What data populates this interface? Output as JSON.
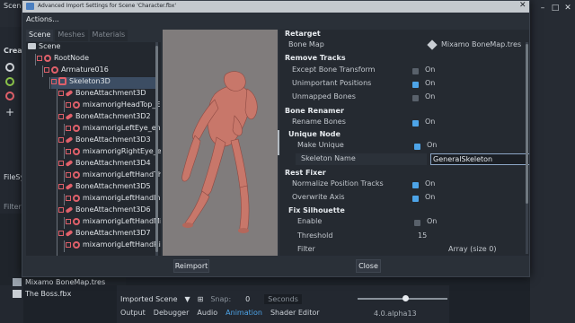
{
  "editor": {
    "scene_tab": "Scene",
    "create_label": "Creat",
    "filesystem_label": "FileSy",
    "filter_label": "Filter",
    "files": [
      "Mixamo BoneMap.tres",
      "The Boss.fbx"
    ],
    "animation_bar": {
      "imported_scene_label": "Imported Scene",
      "snap_label": "Snap:",
      "snap_value": "0",
      "seconds_label": "Seconds"
    },
    "bottom_tabs": [
      "Output",
      "Debugger",
      "Audio",
      "Animation",
      "Shader Editor"
    ],
    "active_bottom_tab": "Animation",
    "version": "4.0.alpha13"
  },
  "dialog": {
    "title": "Advanced Import Settings for Scene 'Character.fbx'",
    "actions_menu": "Actions...",
    "tabs": [
      "Scene",
      "Meshes",
      "Materials"
    ],
    "active_tab": "Scene",
    "tree": [
      {
        "label": "Scene",
        "icon": "folder-icon"
      },
      {
        "label": "RootNode",
        "icon": "node3d-icon"
      },
      {
        "label": "Armature016",
        "icon": "node3d-icon"
      },
      {
        "label": "Skeleton3D",
        "icon": "skeleton-icon"
      },
      {
        "label": "BoneAttachment3D",
        "icon": "bone-icon"
      },
      {
        "label": "mixamorigHeadTop_End_end",
        "icon": "node3d-icon"
      },
      {
        "label": "BoneAttachment3D2",
        "icon": "bone-icon"
      },
      {
        "label": "mixamorigLeftEye_end",
        "icon": "node3d-icon"
      },
      {
        "label": "BoneAttachment3D3",
        "icon": "bone-icon"
      },
      {
        "label": "mixamorigRightEye_end",
        "icon": "node3d-icon"
      },
      {
        "label": "BoneAttachment3D4",
        "icon": "bone-icon"
      },
      {
        "label": "mixamorigLeftHandThumb4_",
        "icon": "node3d-icon"
      },
      {
        "label": "BoneAttachment3D5",
        "icon": "bone-icon"
      },
      {
        "label": "mixamorigLeftHandIndex4_e",
        "icon": "node3d-icon"
      },
      {
        "label": "BoneAttachment3D6",
        "icon": "bone-icon"
      },
      {
        "label": "mixamorigLeftHandMiddle4_",
        "icon": "node3d-icon"
      },
      {
        "label": "BoneAttachment3D7",
        "icon": "bone-icon"
      },
      {
        "label": "mixamorigLeftHandRing4_e",
        "icon": "node3d-icon"
      }
    ],
    "selected_tree_item": "Skeleton3D",
    "inspector": {
      "retarget_header": "Retarget",
      "bone_map_label": "Bone Map",
      "bone_map_value": "Mixamo BoneMap.tres",
      "remove_tracks_header": "Remove Tracks",
      "except_bone_transform": {
        "label": "Except Bone Transform",
        "checked": false,
        "text": "On"
      },
      "unimportant_positions": {
        "label": "Unimportant Positions",
        "checked": true,
        "text": "On"
      },
      "unmapped_bones": {
        "label": "Unmapped Bones",
        "checked": false,
        "text": "On"
      },
      "bone_renamer_header": "Bone Renamer",
      "rename_bones": {
        "label": "Rename Bones",
        "checked": true,
        "text": "On"
      },
      "unique_node_header": "Unique Node",
      "make_unique": {
        "label": "Make Unique",
        "checked": true,
        "text": "On"
      },
      "skeleton_name_label": "Skeleton Name",
      "skeleton_name_value": "GeneralSkeleton",
      "rest_fixer_header": "Rest Fixer",
      "normalize_position_tracks": {
        "label": "Normalize Position Tracks",
        "checked": true,
        "text": "On"
      },
      "overwrite_axis": {
        "label": "Overwrite Axis",
        "checked": true,
        "text": "On"
      },
      "fix_silhouette_header": "Fix Silhouette",
      "enable": {
        "label": "Enable",
        "checked": false,
        "text": "On"
      },
      "threshold_label": "Threshold",
      "threshold_value": "15",
      "filter_label": "Filter",
      "filter_value": "Array (size 0)"
    },
    "reimport_label": "Reimport",
    "close_label": "Close"
  },
  "colors": {
    "accent": "#4da4e8",
    "node_icon": "#e0606a",
    "character_skin": "#c8776a",
    "viewport_bg": "#807c7c"
  }
}
